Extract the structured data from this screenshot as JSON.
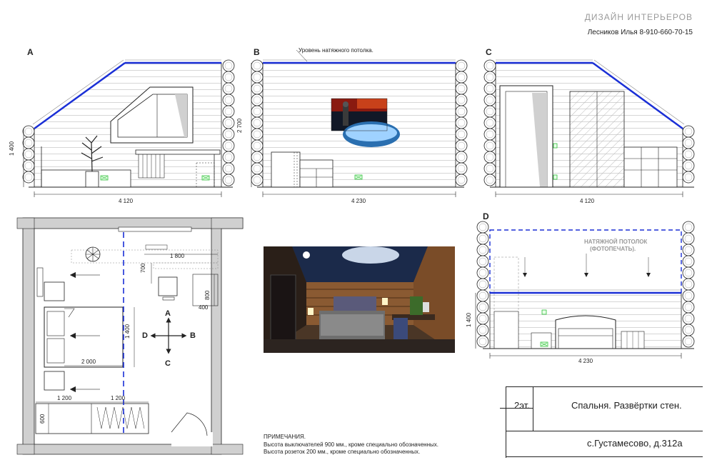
{
  "header": {
    "studio": "ДИЗАЙН ИНТЕРЬЕРОВ",
    "designer": "Лесников Илья 8-910-660-70-15"
  },
  "elevations": {
    "a": {
      "label": "А",
      "width": "4 120",
      "height": "1 400"
    },
    "b": {
      "label": "B",
      "width": "4 230",
      "height": "2 700",
      "ceiling_note": "Уровень натяжного потолка."
    },
    "c": {
      "label": "С",
      "width": "4 120"
    },
    "d": {
      "label": "D",
      "width": "4 230",
      "height": "1 400",
      "ceiling_note_1": "НАТЯЖНОЙ ПОТОЛОК",
      "ceiling_note_2": "(ФОТОПЕЧАТЬ)."
    }
  },
  "plan": {
    "dims": {
      "top_width": "1 800",
      "desk_depth": "700",
      "shelf_height": "800",
      "shelf_width": "400",
      "bed_length": "2 000",
      "bed_width": "1 400",
      "wardrobe_1": "1 200",
      "wardrobe_2": "1 200",
      "wardrobe_depth": "600"
    },
    "compass": {
      "a": "A",
      "b": "B",
      "c": "C",
      "d": "D"
    }
  },
  "notes": {
    "title": "ПРИМЕЧАНИЯ.",
    "line1": "Высота выключателей 900 мм., кроме специально обозначенных.",
    "line2": "Высота розеток 200 мм., кроме специально обозначенных."
  },
  "titleblock": {
    "floor": "2эт.",
    "title": "Спальня. Развёртки стен.",
    "address": "с.Густамесово, д.312а"
  },
  "colors": {
    "line": "#222222",
    "ceiling": "#1a2fd6",
    "socket": "#2fbf3a",
    "wall_fill": "#d0d0d0"
  }
}
